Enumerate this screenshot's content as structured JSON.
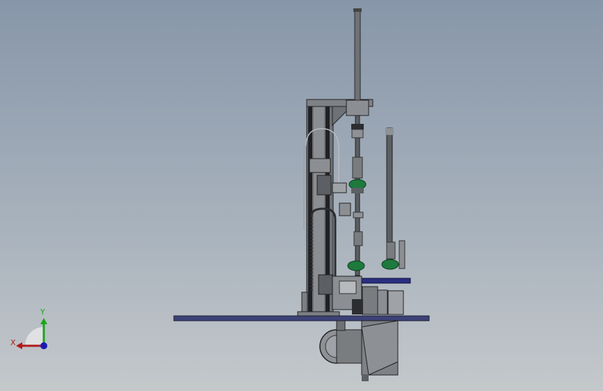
{
  "viewport": {
    "background_top": "#8796a9",
    "background_bottom": "#c4c8cb"
  },
  "triad": {
    "y_label": "Y",
    "x_label": "X",
    "y_color": "#1aa61a",
    "x_color": "#b31a1a",
    "z_color": "#1a1ab3"
  },
  "colors": {
    "base_plate": "#3c4277",
    "secondary_plate": "#2a2f80",
    "frame": "#7c7f84",
    "frame_dark": "#2b2d30",
    "green_part": "#1d7a3c"
  }
}
